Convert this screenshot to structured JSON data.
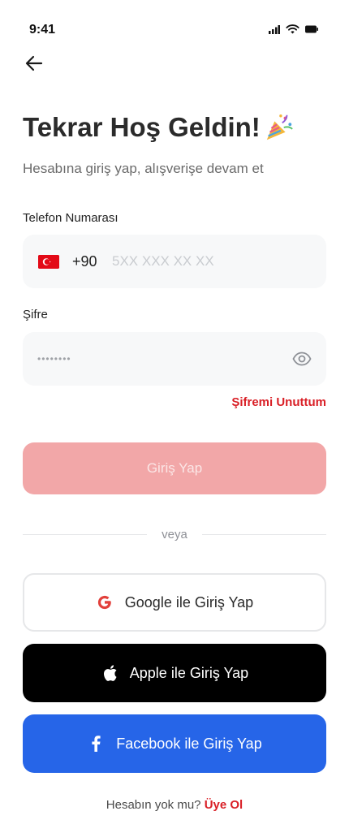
{
  "status_bar": {
    "time": "9:41"
  },
  "header": {
    "title": "Tekrar Hoş Geldin!",
    "subtitle": "Hesabına giriş yap, alışverişe devam et"
  },
  "form": {
    "phone_label": "Telefon Numarası",
    "country_code": "+90",
    "phone_placeholder": "5XX XXX XX XX",
    "phone_value": "",
    "password_label": "Şifre",
    "password_value": "••••••••",
    "forgot_password": "Şifremi Unuttum",
    "submit_label": "Giriş Yap"
  },
  "divider_text": "veya",
  "social": {
    "google_label": "Google ile Giriş Yap",
    "apple_label": "Apple ile Giriş Yap",
    "facebook_label": "Facebook ile Giriş Yap"
  },
  "footer": {
    "prompt": "Hesabın yok mu?",
    "signup_link": "Üye Ol"
  },
  "icons": {
    "back": "arrow-left-icon",
    "party": "party-popper-icon",
    "eye": "eye-icon",
    "google": "google-icon",
    "apple": "apple-icon",
    "facebook": "facebook-icon",
    "flag": "turkey-flag-icon"
  },
  "colors": {
    "accent_red": "#d91f26",
    "disabled_button": "#f2a7a8",
    "facebook_blue": "#2665e8",
    "apple_black": "#000000"
  }
}
